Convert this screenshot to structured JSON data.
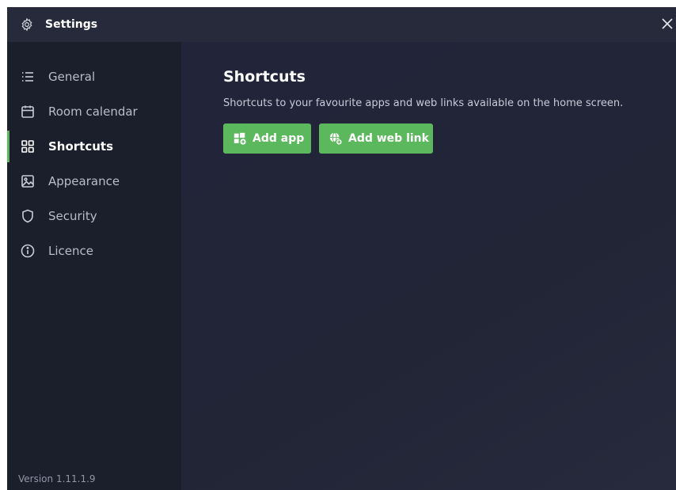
{
  "window": {
    "title": "Settings"
  },
  "sidebar": {
    "items": [
      {
        "label": "General",
        "icon": "list-icon",
        "active": false
      },
      {
        "label": "Room calendar",
        "icon": "calendar-icon",
        "active": false
      },
      {
        "label": "Shortcuts",
        "icon": "grid-icon",
        "active": true
      },
      {
        "label": "Appearance",
        "icon": "image-icon",
        "active": false
      },
      {
        "label": "Security",
        "icon": "shield-icon",
        "active": false
      },
      {
        "label": "Licence",
        "icon": "info-icon",
        "active": false
      }
    ],
    "version": "Version 1.11.1.9"
  },
  "main": {
    "title": "Shortcuts",
    "description": "Shortcuts to your favourite apps and web links available on the home screen.",
    "buttons": {
      "add_app": "Add app",
      "add_web_link": "Add web link"
    }
  },
  "colors": {
    "accent": "#5cb85c",
    "titlebar": "#272a3a",
    "sidebar": "#1b1e2b",
    "main": "#222536"
  }
}
